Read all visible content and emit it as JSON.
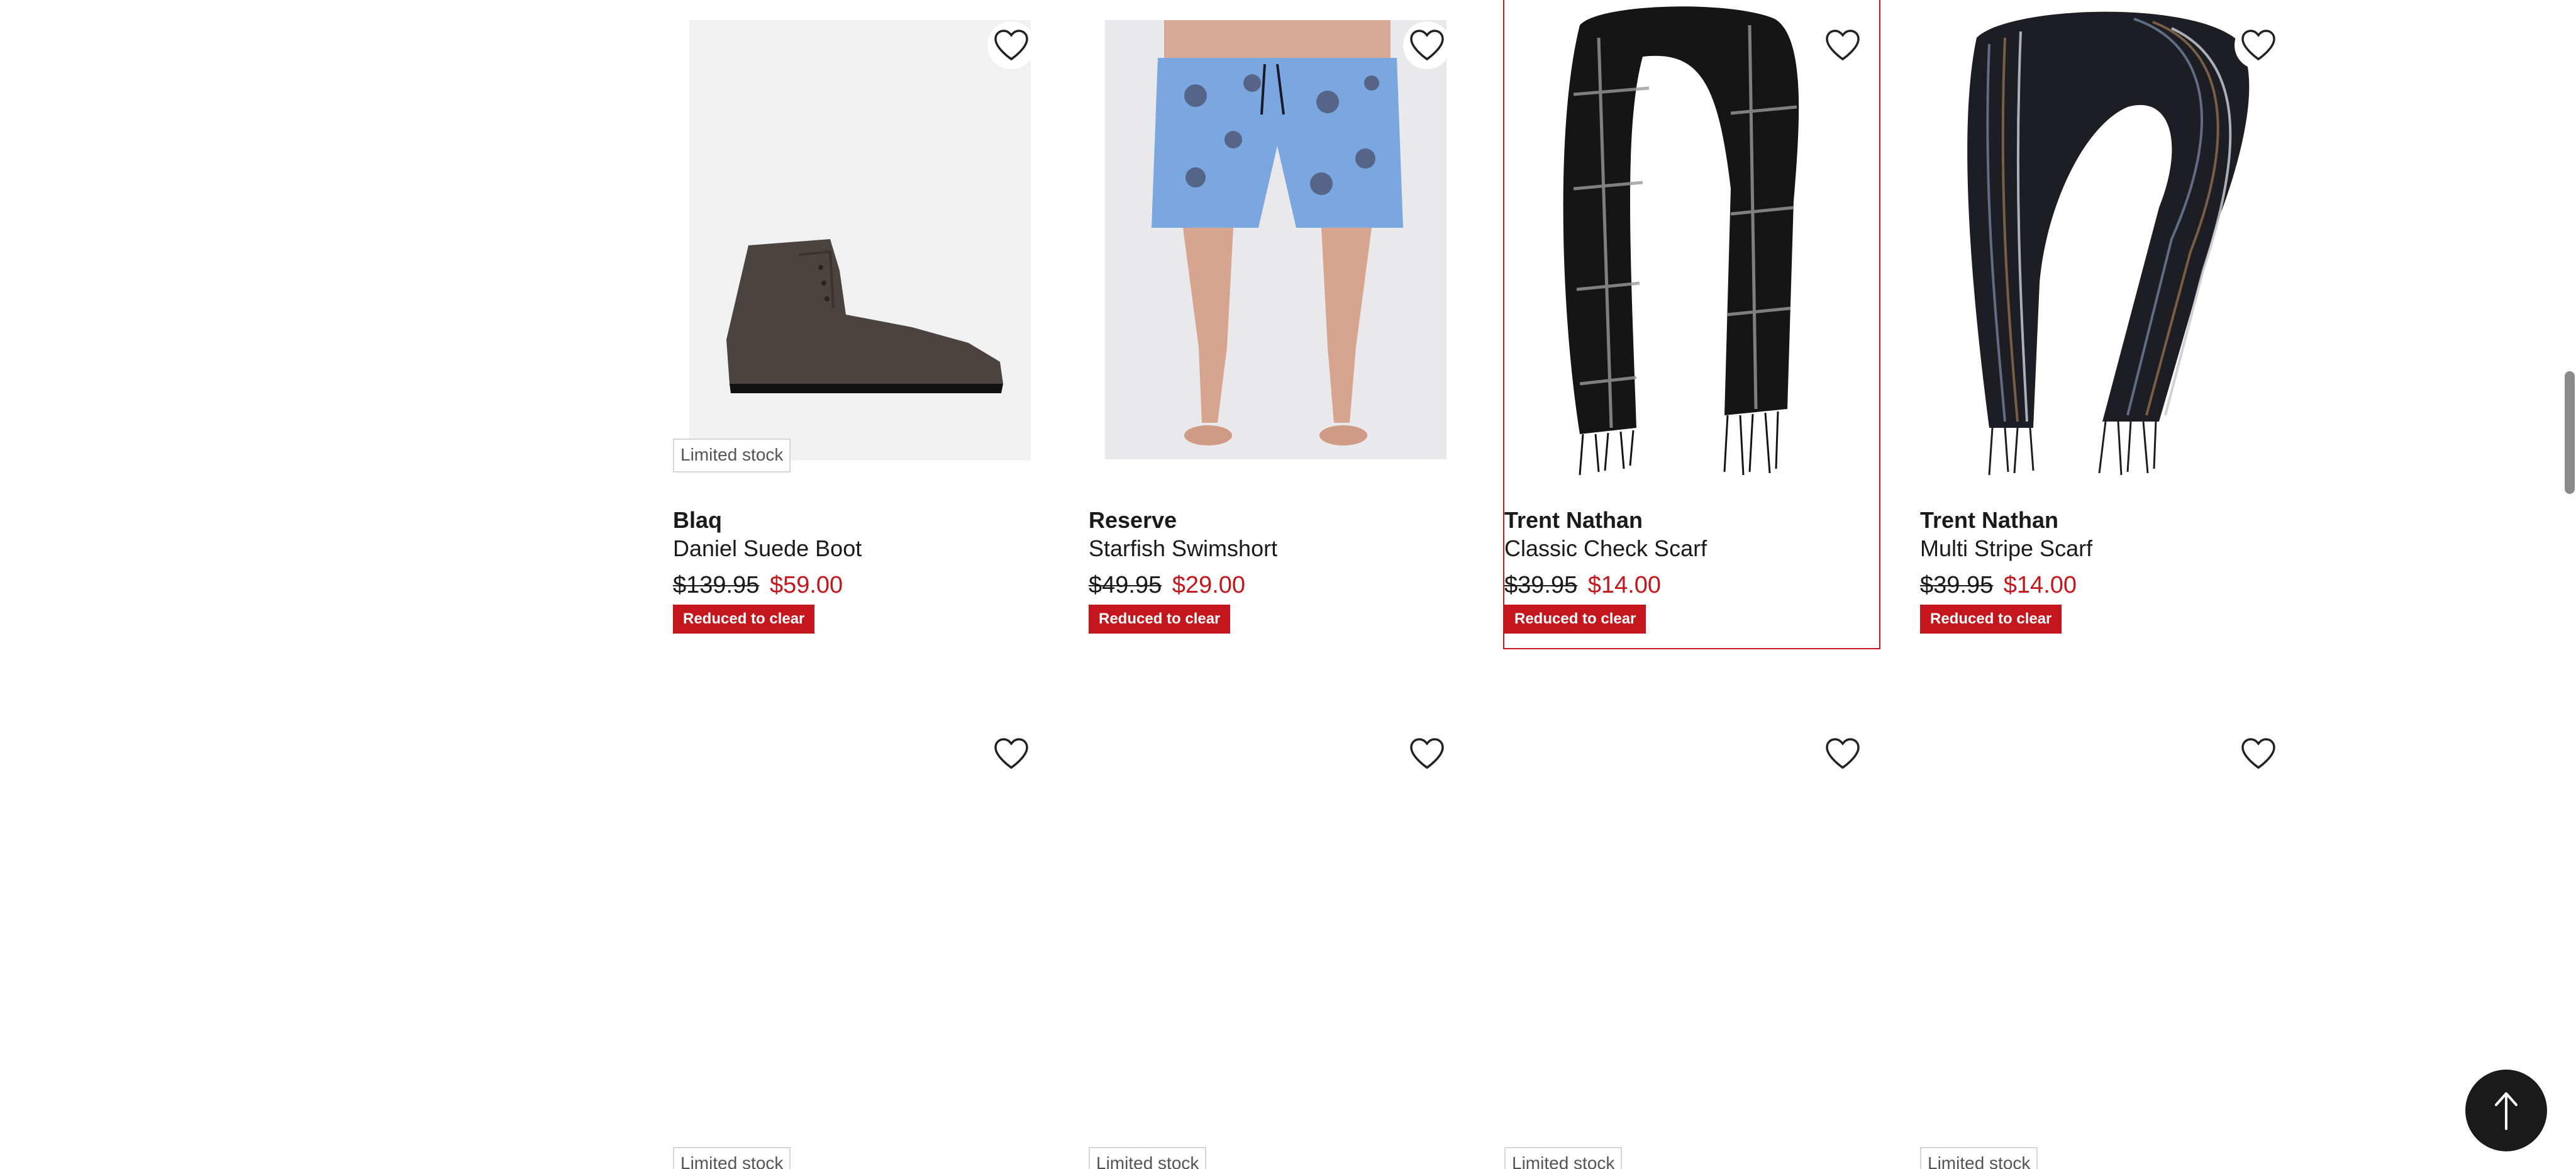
{
  "colors": {
    "sale_red": "#c4161c",
    "text": "#1a1a1a",
    "image_bg": "#f1f1f1"
  },
  "products_row1": [
    {
      "brand": "Blaq",
      "name": "Daniel Suede Boot",
      "was_price": "$139.95",
      "now_price": "$59.00",
      "badge": "Reduced to clear",
      "stock_label": "Limited stock",
      "image": "brown-suede-chukka-boot",
      "icon": "heart-outline-icon"
    },
    {
      "brand": "Reserve",
      "name": "Starfish Swimshort",
      "was_price": "$49.95",
      "now_price": "$29.00",
      "badge": "Reduced to clear",
      "image": "blue-starfish-swim-shorts",
      "icon": "heart-outline-icon"
    },
    {
      "brand": "Trent Nathan",
      "name": "Classic Check Scarf",
      "was_price": "$39.95",
      "now_price": "$14.00",
      "badge": "Reduced to clear",
      "image": "black-check-scarf",
      "icon": "heart-outline-icon"
    },
    {
      "brand": "Trent Nathan",
      "name": "Multi Stripe Scarf",
      "was_price": "$39.95",
      "now_price": "$14.00",
      "badge": "Reduced to clear",
      "image": "multi-stripe-scarf",
      "icon": "heart-outline-icon"
    }
  ],
  "products_row2": [
    {
      "stock_label": "Limited stock",
      "icon": "heart-outline-icon"
    },
    {
      "stock_label": "Limited stock",
      "icon": "heart-outline-icon"
    },
    {
      "stock_label": "Limited stock",
      "icon": "heart-outline-icon"
    },
    {
      "stock_label": "Limited stock",
      "icon": "heart-outline-icon"
    }
  ],
  "scroll_top_icon": "arrow-up-icon"
}
